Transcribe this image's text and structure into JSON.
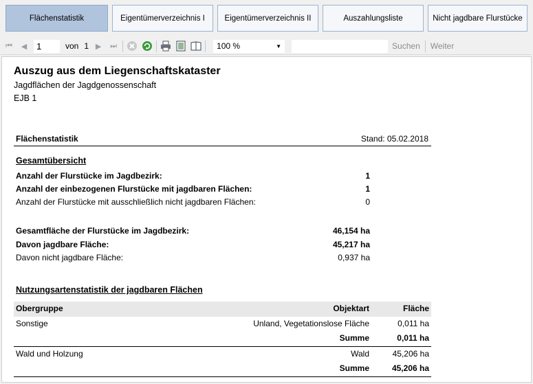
{
  "tabs": [
    {
      "label": "Flächenstatistik"
    },
    {
      "label": "Eigentümerverzeichnis I"
    },
    {
      "label": "Eigentümerverzeichnis II"
    },
    {
      "label": "Auszahlungsliste"
    },
    {
      "label": "Nicht jagdbare Flurstücke"
    }
  ],
  "toolbar": {
    "page_value": "1",
    "of_label": "von",
    "page_count": "1",
    "zoom_value": "100 %",
    "search_label": "Suchen",
    "next_label": "Weiter"
  },
  "report": {
    "title": "Auszug aus dem Liegenschaftskataster",
    "subtitle": "Jagdflächen der Jagdgenossenschaft",
    "code": "EJB 1",
    "header_left": "Flächenstatistik",
    "header_right": "Stand: 05.02.2018",
    "overview_title": "Gesamtübersicht",
    "overview": [
      {
        "label": "Anzahl der Flurstücke im Jagdbezirk:",
        "value": "1",
        "bold": true
      },
      {
        "label": "Anzahl der einbezogenen Flurstücke mit jagdbaren Flächen:",
        "value": "1",
        "bold": true
      },
      {
        "label": "Anzahl der Flurstücke mit ausschließlich nicht jagdbaren Flächen:",
        "value": "0",
        "bold": false
      }
    ],
    "areas": [
      {
        "label": "Gesamtfläche der Flurstücke im Jagdbezirk:",
        "value": "46,154 ha",
        "bold": true
      },
      {
        "label": "Davon jagdbare Fläche:",
        "value": "45,217 ha",
        "bold": true
      },
      {
        "label": "Davon nicht jagdbare Fläche:",
        "value": "0,937 ha",
        "bold": false
      }
    ],
    "usage_title": "Nutzungsartenstatistik der jagdbaren Flächen",
    "table_headers": {
      "group": "Obergruppe",
      "type": "Objektart",
      "area": "Fläche"
    },
    "table_rows": [
      {
        "group": "Sonstige",
        "type": "Unland, Vegetationslose Fläche",
        "area": "0,011 ha"
      },
      {
        "group": "",
        "type": "Summe",
        "area": "0,011 ha",
        "sum": true
      },
      {
        "group": "Wald und Holzung",
        "type": "Wald",
        "area": "45,206 ha"
      },
      {
        "group": "",
        "type": "Summe",
        "area": "45,206 ha",
        "sum": true
      }
    ]
  }
}
